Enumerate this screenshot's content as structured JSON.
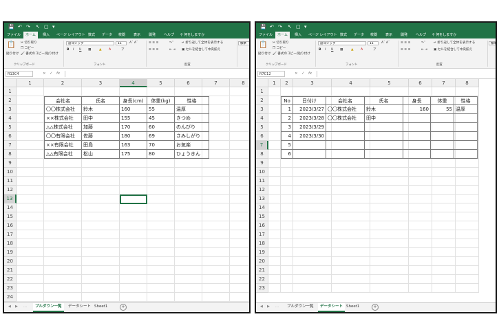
{
  "colors": {
    "accent": "#217346",
    "border": "#1b1b1b"
  },
  "ribbon_common": {
    "tabs": [
      "ファイル",
      "ホーム",
      "挿入",
      "ページ レイアウト",
      "数式",
      "データ",
      "校閲",
      "表示",
      "開発",
      "ヘルプ",
      "何をしますか"
    ],
    "paste_label": "貼り付け",
    "cut_label": "切り取り",
    "copy_label": "コピー",
    "format_painter_label": "書式のコピー/貼り付け",
    "clipboard_group": "クリップボード",
    "font_name": "游ゴシック",
    "font_size": "11",
    "font_group": "フォント",
    "wrap_label": "折り返して全体を表示する",
    "merge_label": "セルを結合して中央揃え",
    "align_group": "配置",
    "number_format": "標準"
  },
  "win1": {
    "name_box": "R13C4",
    "fx": "fx",
    "col_headers": [
      "1",
      "2",
      "3",
      "4",
      "5",
      "6",
      "7",
      "8"
    ],
    "row_headers": [
      "1",
      "2",
      "3",
      "4",
      "5",
      "6",
      "7",
      "8",
      "9",
      "10",
      "11",
      "12",
      "13",
      "14",
      "15",
      "16",
      "17",
      "18",
      "19",
      "20",
      "21",
      "22",
      "23",
      "24"
    ],
    "table_headers": [
      "会社名",
      "氏名",
      "身長(cm)",
      "体重(kg)",
      "性格"
    ],
    "table_rows": [
      [
        "〇〇株式会社",
        "鈴木",
        "160",
        "55",
        "温厚"
      ],
      [
        "××株式会社",
        "田中",
        "155",
        "45",
        "きつめ"
      ],
      [
        "△△株式会社",
        "加藤",
        "170",
        "60",
        "のんびり"
      ],
      [
        "〇〇有限会社",
        "佐藤",
        "180",
        "69",
        "さみしがり"
      ],
      [
        "××有限会社",
        "田島",
        "163",
        "70",
        "お気楽"
      ],
      [
        "△△有限会社",
        "松山",
        "175",
        "80",
        "ひょうきん"
      ]
    ],
    "sheet_tabs": [
      "プルダウン一覧",
      "データシート",
      "Sheet1"
    ],
    "active_sheet": "プルダウン一覧"
  },
  "win2": {
    "name_box": "R7C12",
    "fx": "fx",
    "col_headers": [
      "1",
      "2",
      "3",
      "4",
      "5",
      "6",
      "7",
      "8"
    ],
    "row_headers": [
      "1",
      "2",
      "3",
      "4",
      "5",
      "6",
      "7",
      "8",
      "9",
      "10",
      "11",
      "12",
      "13",
      "14",
      "15",
      "16",
      "17",
      "18",
      "19",
      "20",
      "21",
      "22",
      "23"
    ],
    "table_headers": [
      "No",
      "日付け",
      "会社名",
      "氏名",
      "身長",
      "体重",
      "性格"
    ],
    "table_rows": [
      [
        "1",
        "2023/3/27",
        "〇〇株式会社",
        "鈴木",
        "160",
        "55",
        "温厚"
      ],
      [
        "2",
        "2023/3/28",
        "〇〇株式会社",
        "田中",
        "",
        "",
        ""
      ],
      [
        "3",
        "2023/3/29",
        "",
        "",
        "",
        "",
        ""
      ],
      [
        "4",
        "2023/3/30",
        "",
        "",
        "",
        "",
        ""
      ],
      [
        "5",
        "",
        "",
        "",
        "",
        "",
        ""
      ],
      [
        "6",
        "",
        "",
        "",
        "",
        "",
        ""
      ]
    ],
    "sheet_tabs": [
      "プルダウン一覧",
      "データシート",
      "Sheet1"
    ],
    "active_sheet": "データシート"
  }
}
